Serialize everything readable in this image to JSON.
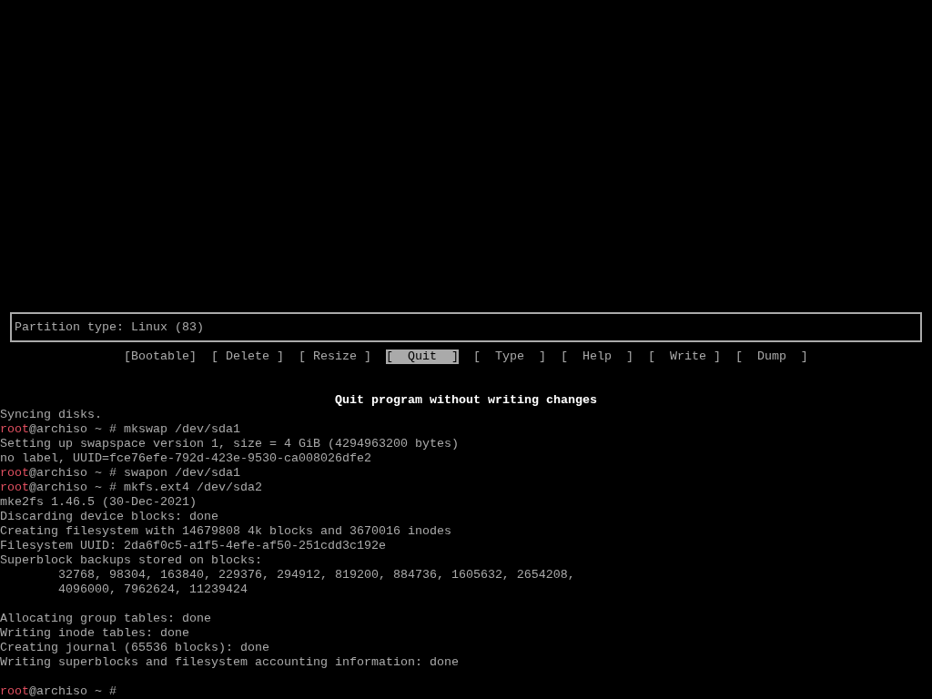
{
  "status_box": {
    "text": "Partition type: Linux (83)"
  },
  "buttons": [
    {
      "label": "[Bootable]",
      "selected": false
    },
    {
      "label": "[ Delete ]",
      "selected": false
    },
    {
      "label": "[ Resize ]",
      "selected": false
    },
    {
      "label": "[  Quit  ]",
      "selected": true
    },
    {
      "label": "[  Type  ]",
      "selected": false
    },
    {
      "label": "[  Help  ]",
      "selected": false
    },
    {
      "label": "[  Write ]",
      "selected": false
    },
    {
      "label": "[  Dump  ]",
      "selected": false
    }
  ],
  "hint": "Quit program without writing changes",
  "terminal_lines": [
    {
      "kind": "output",
      "text": "Syncing disks."
    },
    {
      "kind": "prompt",
      "user": "root",
      "host": "@archiso ~ # ",
      "command": "mkswap /dev/sda1"
    },
    {
      "kind": "output",
      "text": "Setting up swapspace version 1, size = 4 GiB (4294963200 bytes)"
    },
    {
      "kind": "output",
      "text": "no label, UUID=fce76efe-792d-423e-9530-ca008026dfe2"
    },
    {
      "kind": "prompt",
      "user": "root",
      "host": "@archiso ~ # ",
      "command": "swapon /dev/sda1"
    },
    {
      "kind": "prompt",
      "user": "root",
      "host": "@archiso ~ # ",
      "command": "mkfs.ext4 /dev/sda2"
    },
    {
      "kind": "output",
      "text": "mke2fs 1.46.5 (30-Dec-2021)"
    },
    {
      "kind": "output",
      "text": "Discarding device blocks: done"
    },
    {
      "kind": "output",
      "text": "Creating filesystem with 14679808 4k blocks and 3670016 inodes"
    },
    {
      "kind": "output",
      "text": "Filesystem UUID: 2da6f0c5-a1f5-4efe-af50-251cdd3c192e"
    },
    {
      "kind": "output",
      "text": "Superblock backups stored on blocks:"
    },
    {
      "kind": "output",
      "text": "        32768, 98304, 163840, 229376, 294912, 819200, 884736, 1605632, 2654208,"
    },
    {
      "kind": "output",
      "text": "        4096000, 7962624, 11239424"
    },
    {
      "kind": "blank"
    },
    {
      "kind": "output",
      "text": "Allocating group tables: done"
    },
    {
      "kind": "output",
      "text": "Writing inode tables: done"
    },
    {
      "kind": "output",
      "text": "Creating journal (65536 blocks): done"
    },
    {
      "kind": "output",
      "text": "Writing superblocks and filesystem accounting information: done"
    },
    {
      "kind": "blank"
    },
    {
      "kind": "prompt",
      "user": "root",
      "host": "@archiso ~ # "
    }
  ]
}
